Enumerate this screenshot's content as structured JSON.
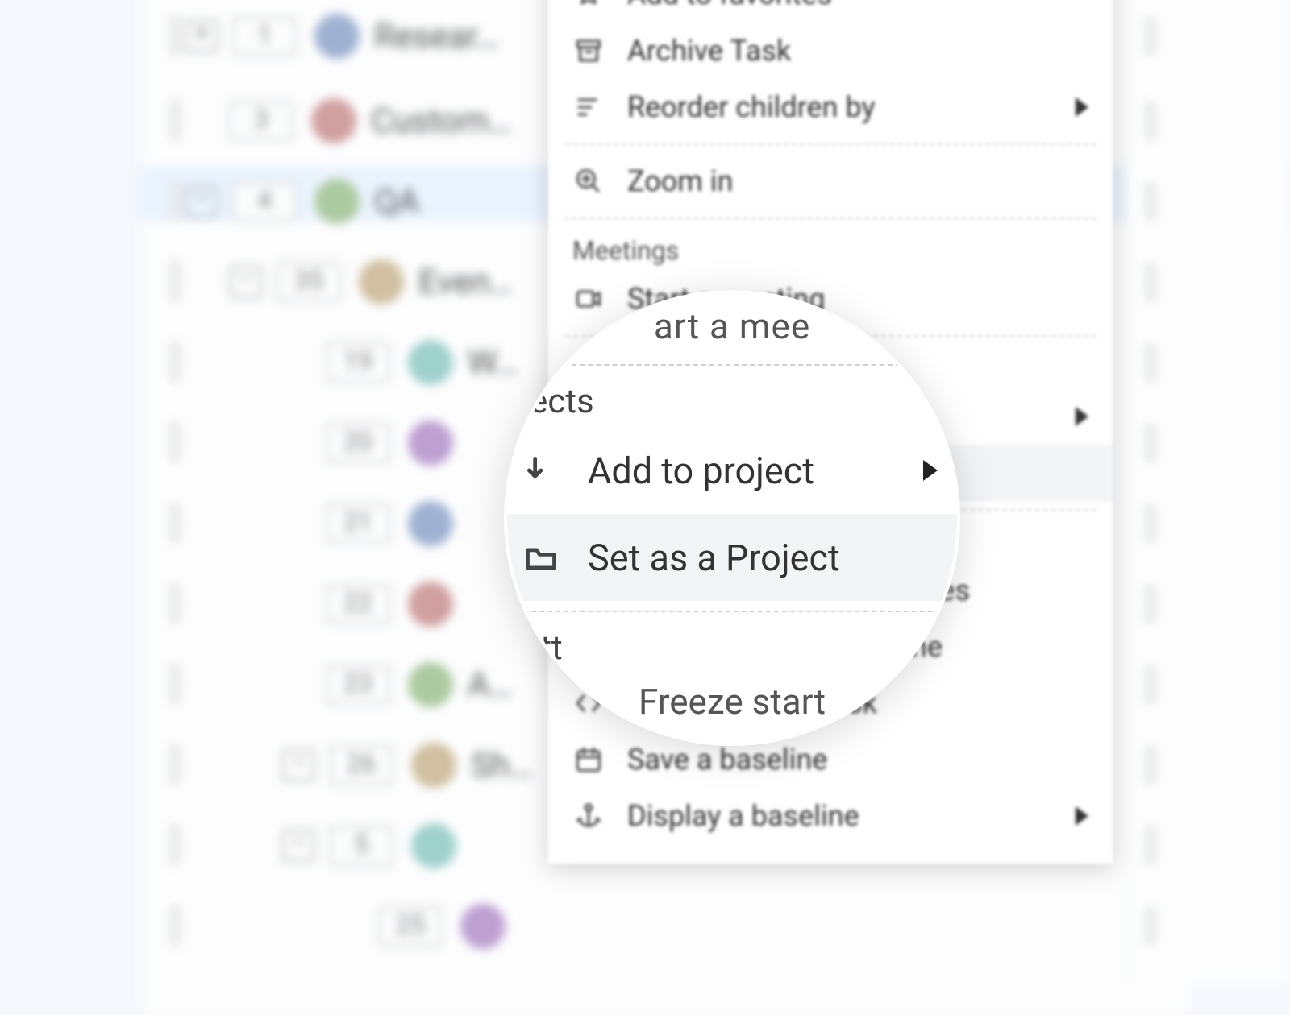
{
  "menu": {
    "addToFavorites": "Add to favorites",
    "archiveTask": "Archive Task",
    "reorderChildren": "Reorder children by",
    "zoomIn": "Zoom in",
    "meetingsSection": "Meetings",
    "startMeeting": "Start a meeting",
    "projectsSection": "Projects",
    "addToProject": "Add to project",
    "setAsProject": "Set as a Project",
    "ganttSection": "Gantt",
    "freezeDates": "Freeze start and end dates",
    "setGanttMilestone": "Set as a Gantt milestone",
    "setBufferTask": "Set as a buffer task",
    "saveBaseline": "Save a baseline",
    "displayBaseline": "Display a baseline"
  },
  "lens": {
    "topFragment": "art a mee",
    "projectsFragment": "jects",
    "addToProject": "Add to project",
    "setAsProject": "Set as a Project",
    "ganttFragment": "ntt",
    "freezeFragmentLeft": "Freeze start",
    "freezeFragmentRight": "d end dates"
  },
  "tasks": [
    {
      "id": 1,
      "name": "Resear…",
      "indent": 0,
      "expand": "plus"
    },
    {
      "id": 3,
      "name": "Custom…",
      "indent": 0,
      "expand": ""
    },
    {
      "id": 4,
      "name": "QA",
      "indent": 0,
      "expand": "minus"
    },
    {
      "id": 35,
      "name": "Even…",
      "indent": 1,
      "expand": "minus"
    },
    {
      "id": 19,
      "name": "W…",
      "indent": 2,
      "expand": ""
    },
    {
      "id": 20,
      "name": "",
      "indent": 2,
      "expand": ""
    },
    {
      "id": 21,
      "name": "",
      "indent": 2,
      "expand": ""
    },
    {
      "id": 22,
      "name": "",
      "indent": 2,
      "expand": ""
    },
    {
      "id": 23,
      "name": "A…",
      "indent": 2,
      "expand": ""
    },
    {
      "id": 26,
      "name": "Sh…",
      "indent": 2,
      "expand": "minus"
    },
    {
      "id": 5,
      "name": "",
      "indent": 2,
      "expand": "minus"
    },
    {
      "id": 25,
      "name": "",
      "indent": 3,
      "expand": ""
    }
  ],
  "avatarColors": [
    "#8aa0c8",
    "#c88a8a",
    "#9bbf8a",
    "#c8b28a",
    "#8ac8c0",
    "#b08ac8"
  ]
}
